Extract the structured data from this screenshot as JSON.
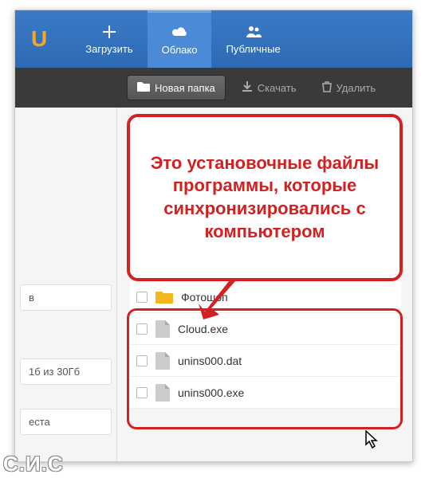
{
  "logo": "U",
  "nav": {
    "upload": "Загрузить",
    "cloud": "Облако",
    "public": "Публичные"
  },
  "toolbar": {
    "new_folder": "Новая папка",
    "download": "Скачать",
    "delete": "Удалить"
  },
  "sidebar": {
    "item1": "в",
    "storage": "1б из 30Гб",
    "item3": "еста"
  },
  "callout": "Это установочные файлы программы, которые синхронизировались с компьютером",
  "files": {
    "folder": "Фотошоп",
    "f1": "Cloud.exe",
    "f2": "unins000.dat",
    "f3": "unins000.exe"
  },
  "watermark": "С.И.С"
}
